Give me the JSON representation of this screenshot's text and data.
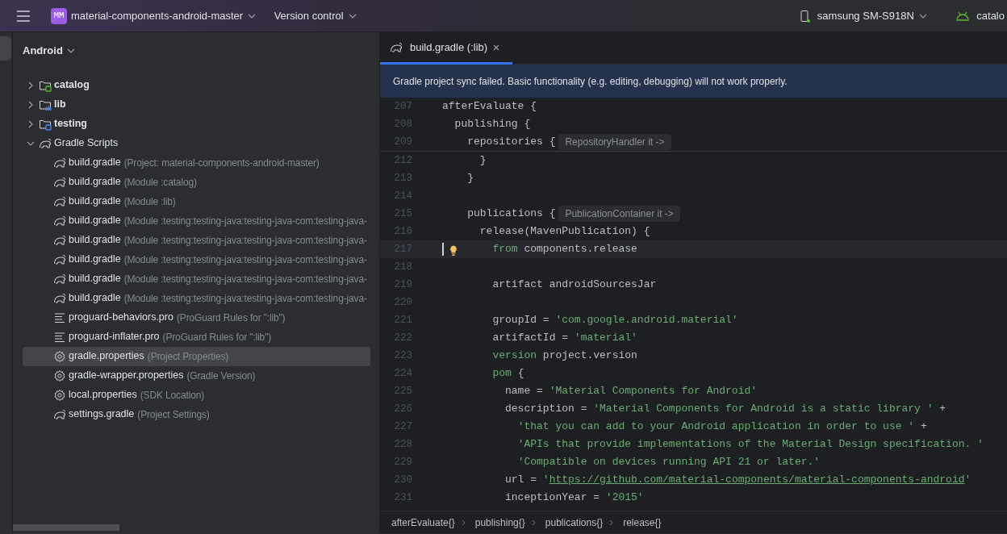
{
  "topbar": {
    "project_badge": "MM",
    "project": "material-components-android-master",
    "vcs": "Version control",
    "device": "samsung SM-S918N",
    "device_online": true,
    "run_config": "catalo"
  },
  "project_panel": {
    "view": "Android",
    "tree": [
      {
        "label": "catalog",
        "kind": "app-module",
        "expanded": false,
        "selected": false
      },
      {
        "label": "lib",
        "kind": "library-module",
        "expanded": false,
        "selected": false
      },
      {
        "label": "testing",
        "kind": "module",
        "expanded": false,
        "selected": false
      },
      {
        "label": "Gradle Scripts",
        "kind": "gradle-group",
        "expanded": true,
        "selected": false,
        "children": [
          {
            "label": "build.gradle",
            "detail": "(Project: material-components-android-master)",
            "kind": "gradle-file",
            "selected": false
          },
          {
            "label": "build.gradle",
            "detail": "(Module :catalog)",
            "kind": "gradle-file",
            "selected": false
          },
          {
            "label": "build.gradle",
            "detail": "(Module :lib)",
            "kind": "gradle-file",
            "selected": false
          },
          {
            "label": "build.gradle",
            "detail": "(Module :testing:testing-java:testing-java-com:testing-java-",
            "kind": "gradle-file",
            "selected": false
          },
          {
            "label": "build.gradle",
            "detail": "(Module :testing:testing-java:testing-java-com:testing-java-",
            "kind": "gradle-file",
            "selected": false
          },
          {
            "label": "build.gradle",
            "detail": "(Module :testing:testing-java:testing-java-com:testing-java-",
            "kind": "gradle-file",
            "selected": false
          },
          {
            "label": "build.gradle",
            "detail": "(Module :testing:testing-java:testing-java-com:testing-java-",
            "kind": "gradle-file",
            "selected": false
          },
          {
            "label": "build.gradle",
            "detail": "(Module :testing:testing-java:testing-java-com:testing-java-",
            "kind": "gradle-file",
            "selected": false
          },
          {
            "label": "proguard-behaviors.pro",
            "detail": "(ProGuard Rules for \":lib\")",
            "kind": "text-file",
            "selected": false
          },
          {
            "label": "proguard-inflater.pro",
            "detail": "(ProGuard Rules for \":lib\")",
            "kind": "text-file",
            "selected": false
          },
          {
            "label": "gradle.properties",
            "detail": "(Project Properties)",
            "kind": "properties-file",
            "selected": true
          },
          {
            "label": "gradle-wrapper.properties",
            "detail": "(Gradle Version)",
            "kind": "properties-file",
            "selected": false
          },
          {
            "label": "local.properties",
            "detail": "(SDK Location)",
            "kind": "properties-file",
            "selected": false
          },
          {
            "label": "settings.gradle",
            "detail": "(Project Settings)",
            "kind": "gradle-file",
            "selected": false
          }
        ]
      }
    ]
  },
  "editor": {
    "tabs": [
      {
        "label": "build.gradle (:lib)",
        "selected": true
      }
    ],
    "banner": "Gradle project sync failed. Basic functionality (e.g. editing, debugging) will not work properly.",
    "sticky_lines": [
      {
        "num": "207",
        "tokens": [
          {
            "kind": "plain",
            "text": "afterEvaluate {"
          }
        ]
      },
      {
        "num": "208",
        "tokens": [
          {
            "kind": "plain",
            "text": "  publishing {"
          }
        ]
      },
      {
        "num": "209",
        "tokens": [
          {
            "kind": "plain",
            "text": "    repositories {"
          }
        ],
        "hint": "RepositoryHandler it ->"
      }
    ],
    "lines": [
      {
        "num": "212",
        "current": false,
        "tokens": [
          {
            "kind": "plain",
            "text": "      }"
          }
        ]
      },
      {
        "num": "213",
        "current": false,
        "tokens": [
          {
            "kind": "plain",
            "text": "    }"
          }
        ]
      },
      {
        "num": "214",
        "current": false
      },
      {
        "num": "215",
        "current": false,
        "tokens": [
          {
            "kind": "plain",
            "text": "    publications {"
          }
        ],
        "hint": "PublicationContainer it ->"
      },
      {
        "num": "216",
        "current": false,
        "tokens": [
          {
            "kind": "plain",
            "text": "      release(MavenPublication) {"
          }
        ]
      },
      {
        "num": "217",
        "current": true,
        "tokens": [
          {
            "kind": "keyword",
            "text": "        from"
          },
          {
            "kind": "plain",
            "text": " components.release"
          }
        ]
      },
      {
        "num": "218",
        "current": false
      },
      {
        "num": "219",
        "current": false,
        "tokens": [
          {
            "kind": "plain",
            "text": "        artifact androidSourcesJar"
          }
        ]
      },
      {
        "num": "220",
        "current": false
      },
      {
        "num": "221",
        "current": false,
        "tokens": [
          {
            "kind": "plain",
            "text": "        groupId = "
          },
          {
            "kind": "string",
            "text": "'com.google.android.material'"
          }
        ]
      },
      {
        "num": "222",
        "current": false,
        "tokens": [
          {
            "kind": "plain",
            "text": "        artifactId = "
          },
          {
            "kind": "string",
            "text": "'material'"
          }
        ]
      },
      {
        "num": "223",
        "current": false,
        "tokens": [
          {
            "kind": "keyword",
            "text": "        version"
          },
          {
            "kind": "plain",
            "text": " project.version"
          }
        ]
      },
      {
        "num": "224",
        "current": false,
        "tokens": [
          {
            "kind": "keyword",
            "text": "        pom"
          },
          {
            "kind": "plain",
            "text": " {"
          }
        ]
      },
      {
        "num": "225",
        "current": false,
        "tokens": [
          {
            "kind": "plain",
            "text": "          name = "
          },
          {
            "kind": "string",
            "text": "'Material Components for Android'"
          }
        ]
      },
      {
        "num": "226",
        "current": false,
        "tokens": [
          {
            "kind": "plain",
            "text": "          description = "
          },
          {
            "kind": "string",
            "text": "'Material Components for Android is a static library '"
          },
          {
            "kind": "plain",
            "text": " +"
          }
        ]
      },
      {
        "num": "227",
        "current": false,
        "tokens": [
          {
            "kind": "string",
            "text": "            'that you can add to your Android application in order to use '"
          },
          {
            "kind": "plain",
            "text": " +"
          }
        ]
      },
      {
        "num": "228",
        "current": false,
        "tokens": [
          {
            "kind": "string",
            "text": "            'APIs that provide implementations of the Material Design specification. '"
          }
        ]
      },
      {
        "num": "229",
        "current": false,
        "tokens": [
          {
            "kind": "string",
            "text": "            'Compatible on devices running API 21 or later.'"
          }
        ]
      },
      {
        "num": "230",
        "current": false,
        "tokens": [
          {
            "kind": "plain",
            "text": "          url = "
          },
          {
            "kind": "string",
            "text": "'"
          },
          {
            "kind": "link",
            "text": "https://github.com/material-components/material-components-android"
          },
          {
            "kind": "string",
            "text": "'"
          }
        ]
      },
      {
        "num": "231",
        "current": false,
        "tokens": [
          {
            "kind": "plain",
            "text": "          inceptionYear = "
          },
          {
            "kind": "string",
            "text": "'2015'"
          }
        ]
      }
    ],
    "breadcrumbs": [
      "afterEvaluate{}",
      "publishing{}",
      "publications{}",
      "release{}"
    ]
  }
}
